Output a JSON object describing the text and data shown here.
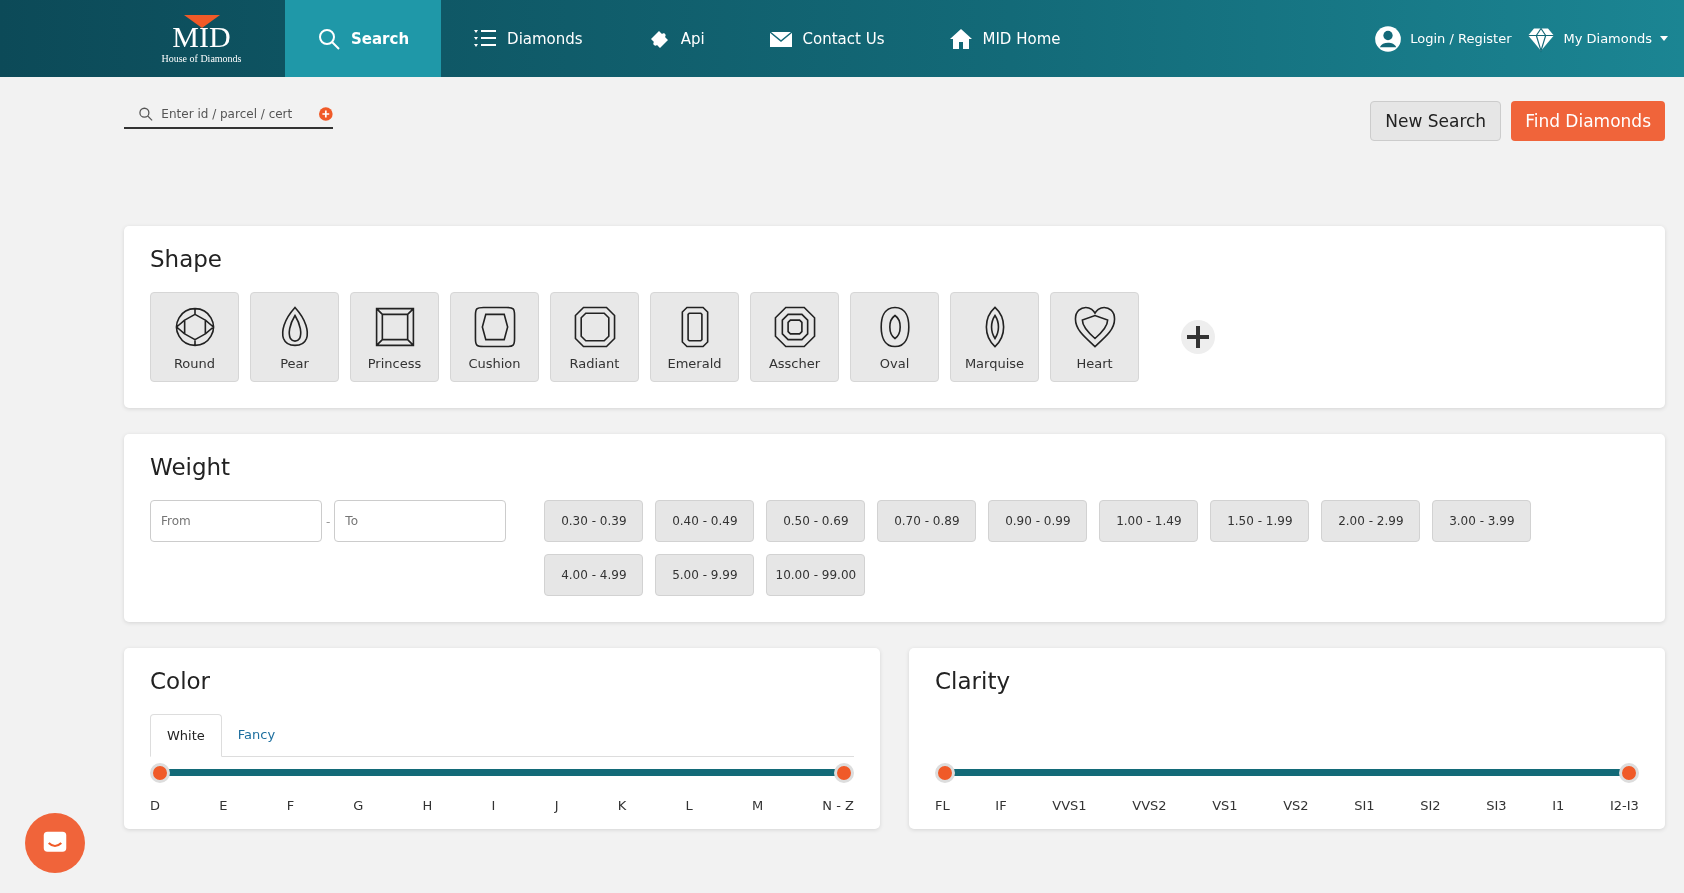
{
  "brand": {
    "name": "MID",
    "tagline": "House of Diamonds"
  },
  "nav": [
    {
      "label": "Search",
      "kind": "search",
      "selected": true
    },
    {
      "label": "Diamonds",
      "kind": "list",
      "selected": false
    },
    {
      "label": "Api",
      "kind": "puzzle",
      "selected": false
    },
    {
      "label": "Contact Us",
      "kind": "mail",
      "selected": false
    },
    {
      "label": "MID Home",
      "kind": "home",
      "selected": false
    }
  ],
  "account": {
    "login": "Login / Register",
    "my_diamonds": "My Diamonds"
  },
  "quick_search": {
    "placeholder": "Enter id / parcel / cert"
  },
  "buttons": {
    "new_search": "New Search",
    "find": "Find Diamonds"
  },
  "shape": {
    "title": "Shape",
    "items": [
      {
        "label": "Round",
        "kind": "round",
        "selected": false
      },
      {
        "label": "Pear",
        "kind": "pear",
        "selected": false
      },
      {
        "label": "Princess",
        "kind": "princess",
        "selected": false
      },
      {
        "label": "Cushion",
        "kind": "cushion",
        "selected": false
      },
      {
        "label": "Radiant",
        "kind": "radiant",
        "selected": false
      },
      {
        "label": "Emerald",
        "kind": "emerald",
        "selected": false
      },
      {
        "label": "Asscher",
        "kind": "asscher",
        "selected": false
      },
      {
        "label": "Oval",
        "kind": "oval",
        "selected": false
      },
      {
        "label": "Marquise",
        "kind": "marquise",
        "selected": false
      },
      {
        "label": "Heart",
        "kind": "heart",
        "selected": false
      }
    ]
  },
  "weight": {
    "title": "Weight",
    "from_placeholder": "From",
    "separator": "-",
    "to_placeholder": "To",
    "ranges": [
      {
        "label": "0.30 - 0.39",
        "selected": false
      },
      {
        "label": "0.40 - 0.49",
        "selected": false
      },
      {
        "label": "0.50 - 0.69",
        "selected": false
      },
      {
        "label": "0.70 - 0.89",
        "selected": false
      },
      {
        "label": "0.90 - 0.99",
        "selected": false
      },
      {
        "label": "1.00 - 1.49",
        "selected": false
      },
      {
        "label": "1.50 - 1.99",
        "selected": false
      },
      {
        "label": "2.00 - 2.99",
        "selected": false
      },
      {
        "label": "3.00 - 3.99",
        "selected": false
      },
      {
        "label": "4.00 - 4.99",
        "selected": false
      },
      {
        "label": "5.00 - 9.99",
        "selected": false
      },
      {
        "label": "10.00 - 99.00",
        "selected": false
      }
    ]
  },
  "color": {
    "title": "Color",
    "tabs": [
      {
        "label": "White",
        "selected": true
      },
      {
        "label": "Fancy",
        "selected": false
      }
    ],
    "slider": {
      "thumbs": [
        {
          "level": 0
        },
        {
          "level": 1
        }
      ],
      "ticks": [
        "D",
        "E",
        "F",
        "G",
        "H",
        "I",
        "J",
        "K",
        "L",
        "M",
        "N - Z"
      ]
    }
  },
  "clarity": {
    "title": "Clarity",
    "slider": {
      "thumbs": [
        {
          "level": 0
        },
        {
          "level": 1
        }
      ],
      "ticks": [
        "FL",
        "IF",
        "VVS1",
        "VVS2",
        "VS1",
        "VS2",
        "SI1",
        "SI2",
        "SI3",
        "I1",
        "I2-I3"
      ]
    }
  }
}
